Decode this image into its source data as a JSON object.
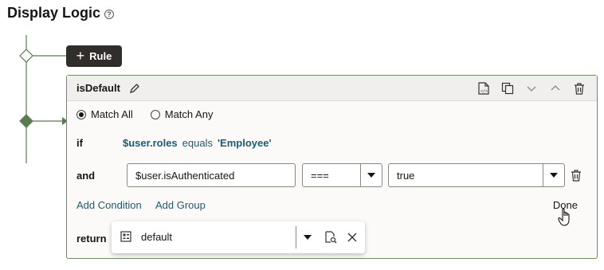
{
  "page": {
    "title": "Display Logic"
  },
  "rule_button": {
    "label": "Rule"
  },
  "card": {
    "name": "isDefault",
    "match_all": "Match All",
    "match_any": "Match Any",
    "match_selected": "all",
    "if_label": "if",
    "if_condition": {
      "field": "$user.roles",
      "operator": "equals",
      "value": "'Employee'"
    },
    "and_label": "and",
    "and_condition": {
      "field": "$user.isAuthenticated",
      "operator": "===",
      "value": "true"
    },
    "add_condition": "Add Condition",
    "add_group": "Add Group",
    "done": "Done",
    "return_label": "return",
    "return_value": "default"
  },
  "icons": {
    "help": "help-icon",
    "edit": "pencil-icon",
    "view_code": "code-file-icon",
    "duplicate": "duplicate-icon",
    "move_down": "chevron-down-icon",
    "move_up": "chevron-up-icon",
    "delete": "trash-icon",
    "variable": "variable-icon",
    "select_variable": "variable-picker-icon",
    "clear": "close-icon"
  },
  "colors": {
    "accent_line": "#5a7b4e",
    "link": "#1c5a75",
    "dark_button": "#312d2a"
  }
}
